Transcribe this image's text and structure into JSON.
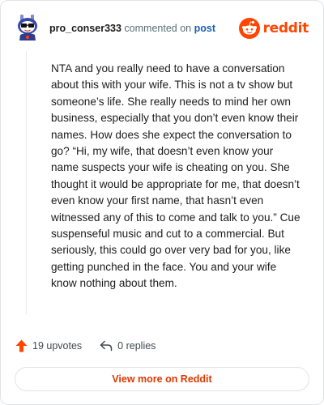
{
  "comment": {
    "username": "pro_conser333",
    "action_text": "commented on",
    "post_link_label": "post",
    "avatar_icon": "snoo-avatar-icon",
    "body": "NTA and you really need to have a conversation about this with your wife. This is not a tv show but someone’s life. She really needs to mind her own business, especially that you don’t even know their names. How does she expect the conversation to go? “Hi, my wife, that doesn’t even know your name suspects your wife is cheating on you. She thought it would be appropriate for me, that doesn’t even know your first name, that hasn’t even witnessed any of this to come and talk to you.” Cue suspenseful music and cut to a commercial. But seriously, this could go over very bad for you, like getting punched in the face. You and your wife know nothing about them."
  },
  "brand": {
    "wordmark": "reddit",
    "logo_icon": "reddit-logo-icon",
    "color": "#ff4500"
  },
  "footer": {
    "upvotes_label": "19 upvotes",
    "upvote_icon": "upvote-arrow-icon",
    "replies_label": "0 replies",
    "reply_icon": "reply-arrow-icon"
  },
  "cta": {
    "view_more_label": "View more on Reddit"
  },
  "colors": {
    "accent": "#ff4500",
    "link": "#1a5fb4",
    "cta_text": "#d93a00"
  }
}
